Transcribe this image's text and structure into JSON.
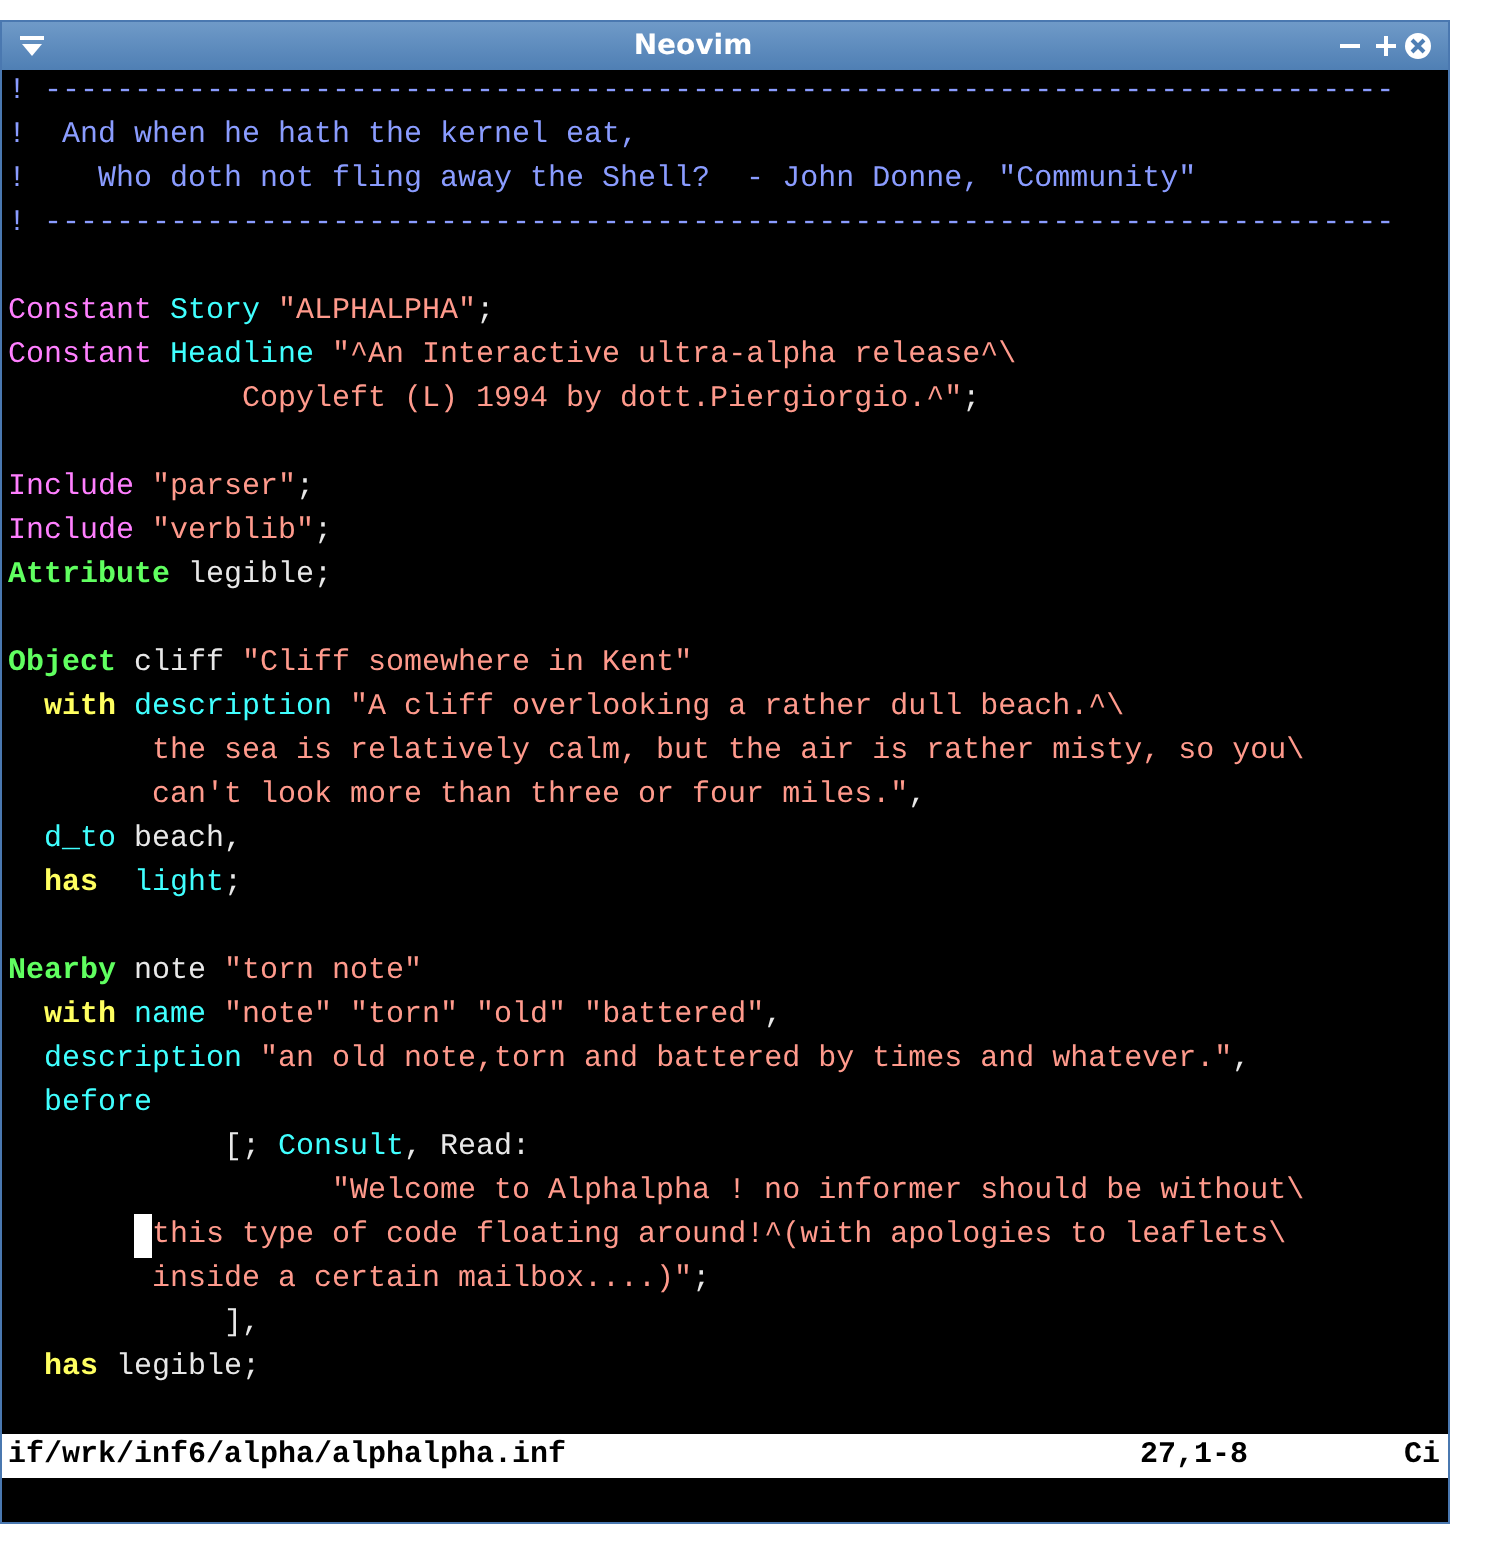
{
  "window": {
    "title": "Neovim"
  },
  "editor": {
    "lines": [
      {
        "tokens": [
          {
            "kind": "comment",
            "text": "! ---------------------------------------------------------------------------"
          }
        ]
      },
      {
        "tokens": [
          {
            "kind": "comment",
            "text": "!  And when he hath the kernel eat,"
          }
        ]
      },
      {
        "tokens": [
          {
            "kind": "comment",
            "text": "!    Who doth not fling away the Shell?  - John Donne, \"Community\""
          }
        ]
      },
      {
        "tokens": [
          {
            "kind": "comment",
            "text": "! ---------------------------------------------------------------------------"
          }
        ]
      },
      {
        "blank": true
      },
      {
        "tokens": [
          {
            "kind": "preproc",
            "text": "Constant"
          },
          {
            "kind": "identifier",
            "text": " Story"
          },
          {
            "kind": "string",
            "text": " \"ALPHALPHA\""
          },
          {
            "kind": "plain",
            "text": ";"
          }
        ]
      },
      {
        "tokens": [
          {
            "kind": "preproc",
            "text": "Constant"
          },
          {
            "kind": "identifier",
            "text": " Headline"
          },
          {
            "kind": "string",
            "text": " \"^An Interactive ultra-alpha release^\\"
          }
        ]
      },
      {
        "tokens": [
          {
            "kind": "string",
            "text": "             Copyleft (L) 1994 by dott.Piergiorgio.^\""
          },
          {
            "kind": "plain",
            "text": ";"
          }
        ]
      },
      {
        "blank": true
      },
      {
        "tokens": [
          {
            "kind": "preproc",
            "text": "Include"
          },
          {
            "kind": "string",
            "text": " \"parser\""
          },
          {
            "kind": "plain",
            "text": ";"
          }
        ]
      },
      {
        "tokens": [
          {
            "kind": "preproc",
            "text": "Include"
          },
          {
            "kind": "string",
            "text": " \"verblib\""
          },
          {
            "kind": "plain",
            "text": ";"
          }
        ]
      },
      {
        "tokens": [
          {
            "kind": "type",
            "text": "Attribute"
          },
          {
            "kind": "plain",
            "text": " legible;"
          }
        ]
      },
      {
        "blank": true
      },
      {
        "tokens": [
          {
            "kind": "type",
            "text": "Object"
          },
          {
            "kind": "plain",
            "text": " cliff"
          },
          {
            "kind": "string",
            "text": " \"Cliff somewhere in Kent\""
          }
        ]
      },
      {
        "tokens": [
          {
            "kind": "keyword",
            "text": "  with"
          },
          {
            "kind": "identifier",
            "text": " description"
          },
          {
            "kind": "string",
            "text": " \"A cliff overlooking a rather dull beach.^\\"
          }
        ]
      },
      {
        "tokens": [
          {
            "kind": "string",
            "text": "        the sea is relatively calm, but the air is rather misty, so you\\"
          }
        ]
      },
      {
        "tokens": [
          {
            "kind": "string",
            "text": "        can't look more than three or four miles.\""
          },
          {
            "kind": "plain",
            "text": ","
          }
        ]
      },
      {
        "tokens": [
          {
            "kind": "identifier",
            "text": "  d_to"
          },
          {
            "kind": "plain",
            "text": " beach,"
          }
        ]
      },
      {
        "tokens": [
          {
            "kind": "keyword",
            "text": "  has"
          },
          {
            "kind": "identifier",
            "text": "  light"
          },
          {
            "kind": "plain",
            "text": ";"
          }
        ]
      },
      {
        "blank": true
      },
      {
        "tokens": [
          {
            "kind": "type",
            "text": "Nearby"
          },
          {
            "kind": "plain",
            "text": " note"
          },
          {
            "kind": "string",
            "text": " \"torn note\""
          }
        ]
      },
      {
        "tokens": [
          {
            "kind": "keyword",
            "text": "  with"
          },
          {
            "kind": "identifier",
            "text": " name"
          },
          {
            "kind": "string",
            "text": " \"note\" \"torn\" \"old\" \"battered\""
          },
          {
            "kind": "plain",
            "text": ","
          }
        ]
      },
      {
        "tokens": [
          {
            "kind": "identifier",
            "text": "  description"
          },
          {
            "kind": "string",
            "text": " \"an old note,torn and battered by times and whatever.\""
          },
          {
            "kind": "plain",
            "text": ","
          }
        ]
      },
      {
        "tokens": [
          {
            "kind": "identifier",
            "text": "  before"
          }
        ]
      },
      {
        "tokens": [
          {
            "kind": "plain",
            "text": "            [;"
          },
          {
            "kind": "identifier",
            "text": " Consult"
          },
          {
            "kind": "plain",
            "text": ", Read:"
          }
        ]
      },
      {
        "tokens": [
          {
            "kind": "string",
            "text": "                  \"Welcome to Alphalpha ! no informer should be without\\"
          }
        ]
      },
      {
        "cursor": true,
        "tokens": [
          {
            "kind": "string",
            "text": "        this type of code floating around!^(with apologies to leaflets\\"
          }
        ]
      },
      {
        "tokens": [
          {
            "kind": "string",
            "text": "        inside a certain mailbox....)\""
          },
          {
            "kind": "plain",
            "text": ";"
          }
        ]
      },
      {
        "tokens": [
          {
            "kind": "plain",
            "text": "            ],"
          }
        ]
      },
      {
        "tokens": [
          {
            "kind": "keyword",
            "text": "  has"
          },
          {
            "kind": "plain",
            "text": " legible;"
          }
        ]
      },
      {
        "blank": true
      }
    ]
  },
  "status_line": {
    "file": "if/wrk/inf6/alpha/alphalpha.inf",
    "position": "27,1-8",
    "column_3": "Ci"
  }
}
